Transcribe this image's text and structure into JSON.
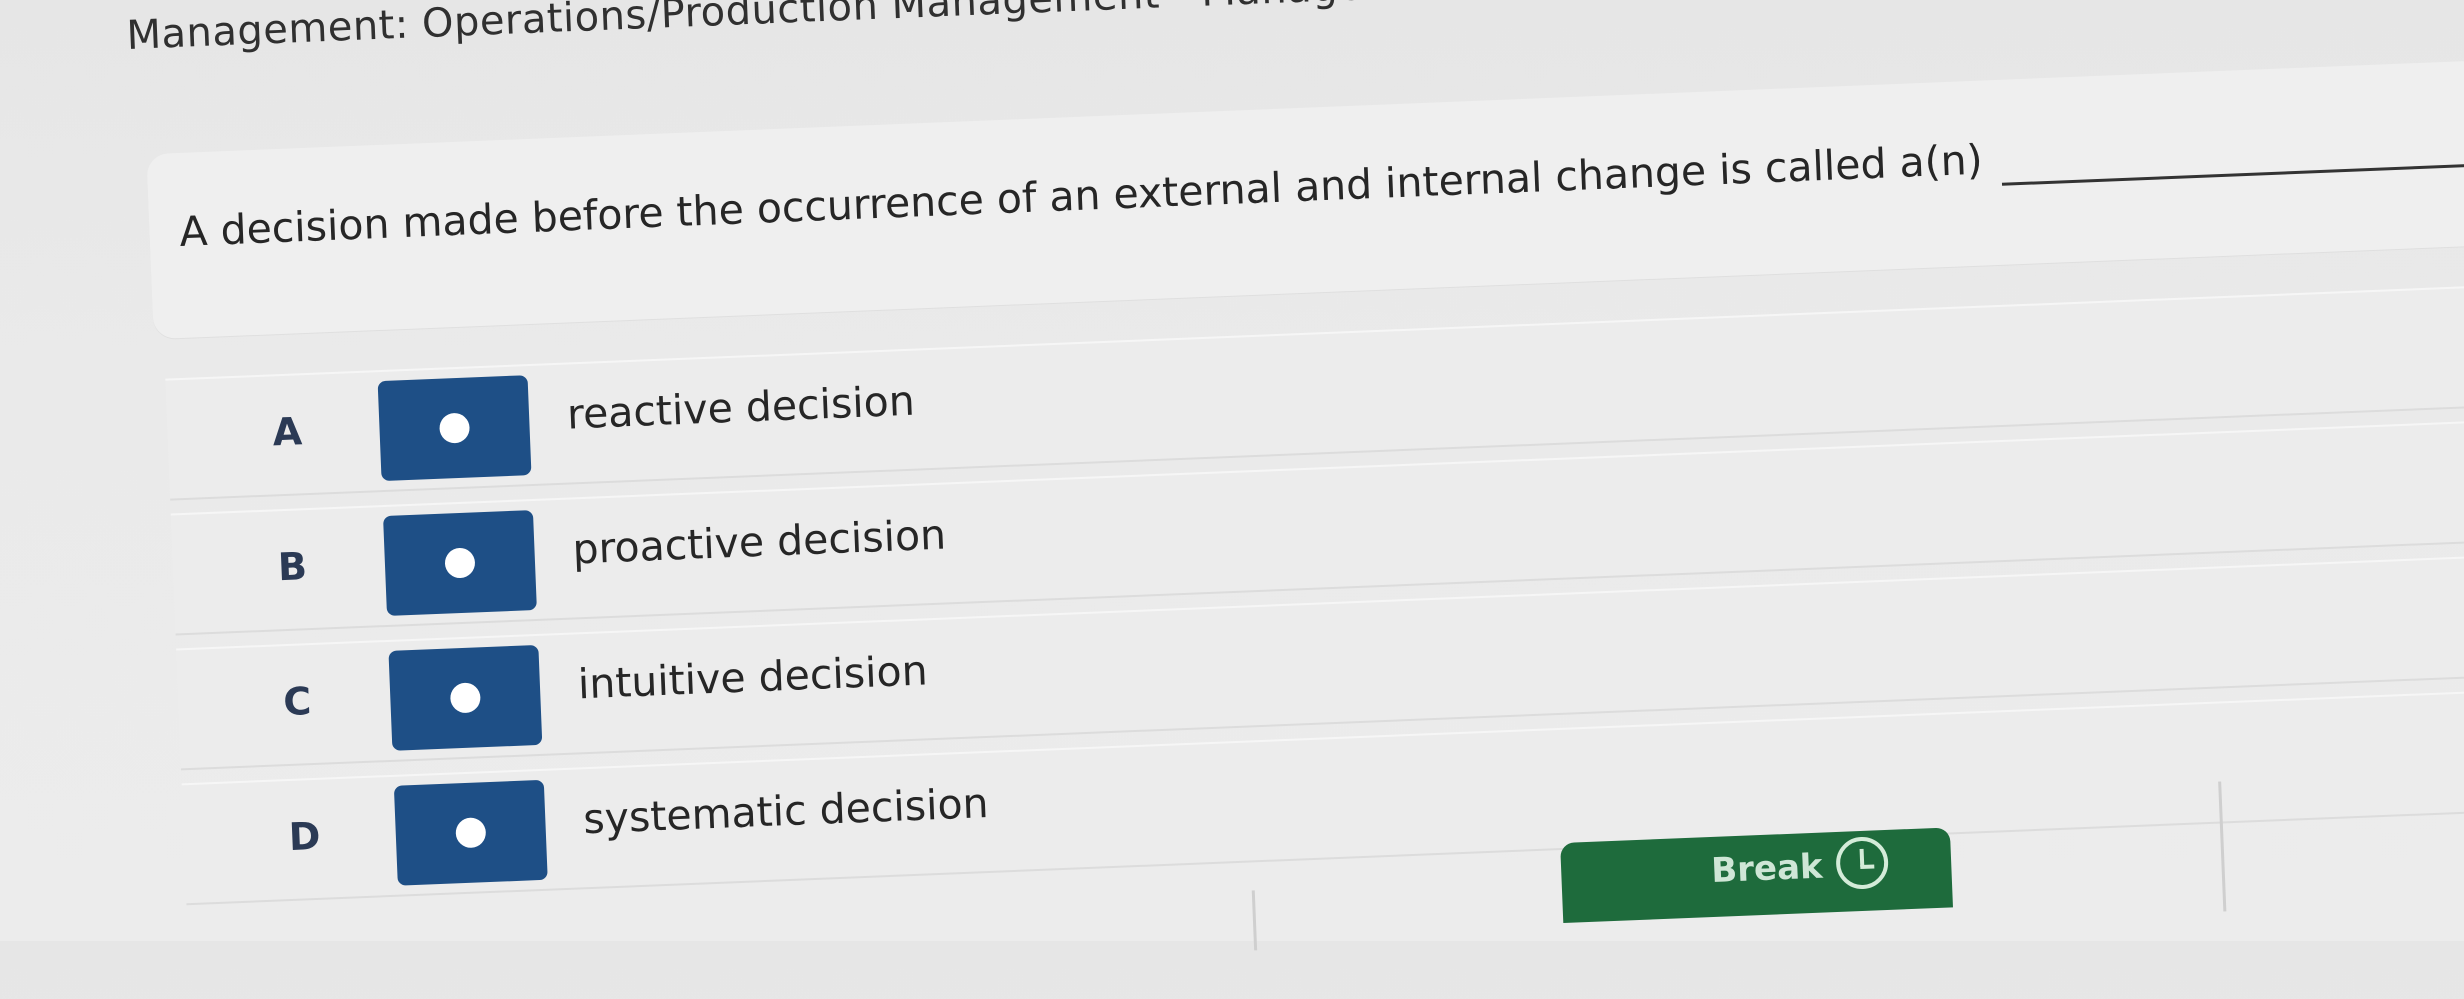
{
  "breadcrumb": "Management: Operations/Production Management - Managem",
  "question": {
    "text": "A decision made before the occurrence of an external and internal change is called a(n)",
    "period": "."
  },
  "options": [
    {
      "letter": "A",
      "text": "reactive decision"
    },
    {
      "letter": "B",
      "text": "proactive decision"
    },
    {
      "letter": "C",
      "text": "intuitive decision"
    },
    {
      "letter": "D",
      "text": "systematic decision"
    }
  ],
  "break_button": {
    "label": "Break",
    "icon": "clock-icon"
  },
  "colors": {
    "radio_box": "#1e4f86",
    "break_button": "#1e6b3c",
    "background": "#e9e9e9"
  }
}
